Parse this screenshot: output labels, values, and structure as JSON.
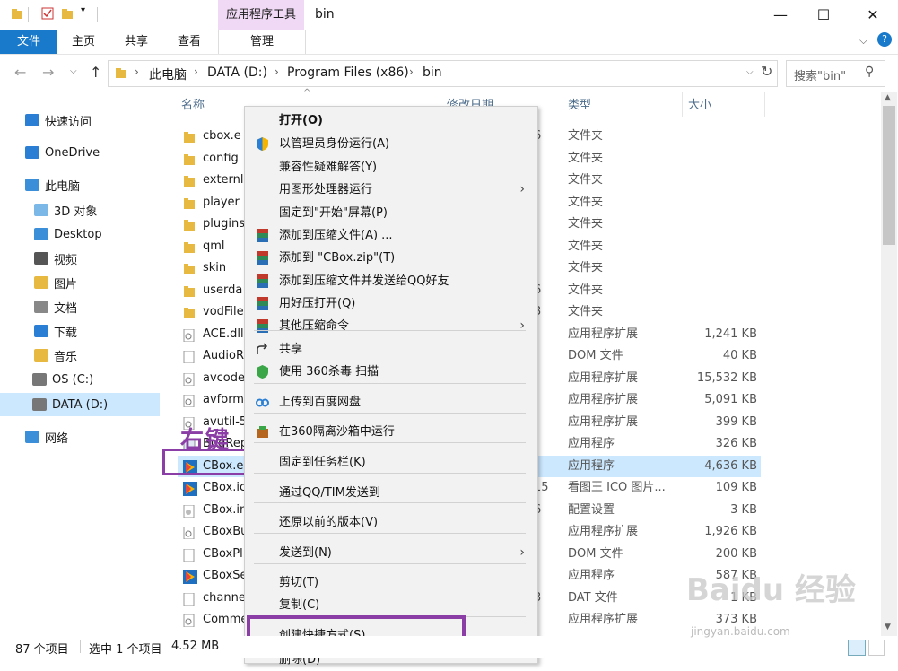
{
  "window": {
    "tool_tab": "应用程序工具",
    "title": "bin",
    "min": "—",
    "max": "☐",
    "close": "✕"
  },
  "ribbon": {
    "tabs": [
      "文件",
      "主页",
      "共享",
      "查看"
    ],
    "manage": "管理"
  },
  "address": {
    "path": [
      "此电脑",
      "DATA (D:)",
      "Program Files (x86)",
      "bin"
    ],
    "search_placeholder": "搜索\"bin\""
  },
  "nav": [
    {
      "label": "快速访问",
      "icon": "star-icon"
    },
    {
      "label": "OneDrive",
      "icon": "cloud-icon"
    },
    {
      "label": "此电脑",
      "icon": "computer-icon"
    },
    {
      "label": "3D 对象",
      "icon": "folder-3d-icon"
    },
    {
      "label": "Desktop",
      "icon": "desktop-icon"
    },
    {
      "label": "视频",
      "icon": "video-icon"
    },
    {
      "label": "图片",
      "icon": "pictures-icon"
    },
    {
      "label": "文档",
      "icon": "documents-icon"
    },
    {
      "label": "下载",
      "icon": "downloads-icon"
    },
    {
      "label": "音乐",
      "icon": "music-icon"
    },
    {
      "label": "OS (C:)",
      "icon": "drive-icon"
    },
    {
      "label": "DATA (D:)",
      "icon": "drive-icon"
    },
    {
      "label": "网络",
      "icon": "network-icon"
    }
  ],
  "columns": {
    "name": "名称",
    "date": "修改日期",
    "type": "类型",
    "size": "大小"
  },
  "files": [
    {
      "name": "cbox.e",
      "date": "6",
      "type": "文件夹",
      "size": "",
      "icon": "folder"
    },
    {
      "name": "config",
      "date": "",
      "type": "文件夹",
      "size": "",
      "icon": "folder"
    },
    {
      "name": "externl",
      "date": "",
      "type": "文件夹",
      "size": "",
      "icon": "folder"
    },
    {
      "name": "player",
      "date": "",
      "type": "文件夹",
      "size": "",
      "icon": "folder"
    },
    {
      "name": "plugins",
      "date": "",
      "type": "文件夹",
      "size": "",
      "icon": "folder"
    },
    {
      "name": "qml",
      "date": "",
      "type": "文件夹",
      "size": "",
      "icon": "folder"
    },
    {
      "name": "skin",
      "date": "",
      "type": "文件夹",
      "size": "",
      "icon": "folder"
    },
    {
      "name": "userda",
      "date": "6",
      "type": "文件夹",
      "size": "",
      "icon": "folder"
    },
    {
      "name": "vodFile",
      "date": "3",
      "type": "文件夹",
      "size": "",
      "icon": "folder"
    },
    {
      "name": "ACE.dll",
      "date": "",
      "type": "应用程序扩展",
      "size": "1,241 KB",
      "icon": "dll"
    },
    {
      "name": "AudioR",
      "date": "",
      "type": "DOM 文件",
      "size": "40 KB",
      "icon": "file"
    },
    {
      "name": "avcode",
      "date": "",
      "type": "应用程序扩展",
      "size": "15,532 KB",
      "icon": "dll"
    },
    {
      "name": "avform",
      "date": "",
      "type": "应用程序扩展",
      "size": "5,091 KB",
      "icon": "dll"
    },
    {
      "name": "avutil-5",
      "date": "",
      "type": "应用程序扩展",
      "size": "399 KB",
      "icon": "dll"
    },
    {
      "name": "BugRep",
      "date": "",
      "type": "应用程序",
      "size": "326 KB",
      "icon": "app"
    },
    {
      "name": "CBox.e",
      "date": "",
      "type": "应用程序",
      "size": "4,636 KB",
      "icon": "cbox"
    },
    {
      "name": "CBox.ic",
      "date": "15",
      "type": "看图王 ICO 图片...",
      "size": "109 KB",
      "icon": "cbox"
    },
    {
      "name": "CBox.in",
      "date": "6",
      "type": "配置设置",
      "size": "3 KB",
      "icon": "ini"
    },
    {
      "name": "CBoxBu",
      "date": "",
      "type": "应用程序扩展",
      "size": "1,926 KB",
      "icon": "dll"
    },
    {
      "name": "CBoxPl",
      "date": "",
      "type": "DOM 文件",
      "size": "200 KB",
      "icon": "file"
    },
    {
      "name": "CBoxSe",
      "date": "",
      "type": "应用程序",
      "size": "587 KB",
      "icon": "cbox"
    },
    {
      "name": "channe",
      "date": "3",
      "type": "DAT 文件",
      "size": "1 KB",
      "icon": "file"
    },
    {
      "name": "Comme",
      "date": "",
      "type": "应用程序扩展",
      "size": "373 KB",
      "icon": "dll"
    }
  ],
  "menu": [
    {
      "label": "打开(O)",
      "bold": true,
      "icon": "",
      "arrow": false
    },
    {
      "label": "以管理员身份运行(A)",
      "icon": "shield",
      "arrow": false
    },
    {
      "label": "兼容性疑难解答(Y)",
      "icon": "",
      "arrow": false
    },
    {
      "label": "用图形处理器运行",
      "icon": "",
      "arrow": true
    },
    {
      "label": "固定到\"开始\"屏幕(P)",
      "icon": "",
      "arrow": false
    },
    {
      "label": "添加到压缩文件(A) ...",
      "icon": "rar",
      "arrow": false
    },
    {
      "label": "添加到 \"CBox.zip\"(T)",
      "icon": "rar",
      "arrow": false
    },
    {
      "label": "添加到压缩文件并发送给QQ好友",
      "icon": "rar",
      "arrow": false
    },
    {
      "label": "用好压打开(Q)",
      "icon": "rar",
      "arrow": false
    },
    {
      "label": "其他压缩命令",
      "icon": "rar",
      "arrow": true
    },
    {
      "label": "共享",
      "icon": "share",
      "arrow": false
    },
    {
      "label": "使用 360杀毒 扫描",
      "icon": "av360",
      "arrow": false
    },
    {
      "label": "上传到百度网盘",
      "icon": "baidu",
      "arrow": false
    },
    {
      "label": "在360隔离沙箱中运行",
      "icon": "sandbox",
      "arrow": false
    },
    {
      "label": "固定到任务栏(K)",
      "icon": "",
      "arrow": false
    },
    {
      "label": "通过QQ/TIM发送到",
      "icon": "",
      "arrow": false
    },
    {
      "label": "还原以前的版本(V)",
      "icon": "",
      "arrow": false
    },
    {
      "label": "发送到(N)",
      "icon": "",
      "arrow": true
    },
    {
      "label": "剪切(T)",
      "icon": "",
      "arrow": false
    },
    {
      "label": "复制(C)",
      "icon": "",
      "arrow": false
    },
    {
      "label": "创建快捷方式(S)",
      "icon": "",
      "arrow": false
    },
    {
      "label": "删除(D)",
      "icon": "",
      "arrow": false
    }
  ],
  "status": {
    "count": "87 个项目",
    "selected": "选中 1 个项目",
    "size": "4.52 MB"
  },
  "annotation": {
    "label": "右键"
  },
  "watermark": {
    "text": "Baidu 经验",
    "url": "jingyan.baidu.com"
  },
  "colors": {
    "accent": "#1979ca",
    "annotation": "#8b3ea5",
    "selection": "#cce8ff"
  }
}
